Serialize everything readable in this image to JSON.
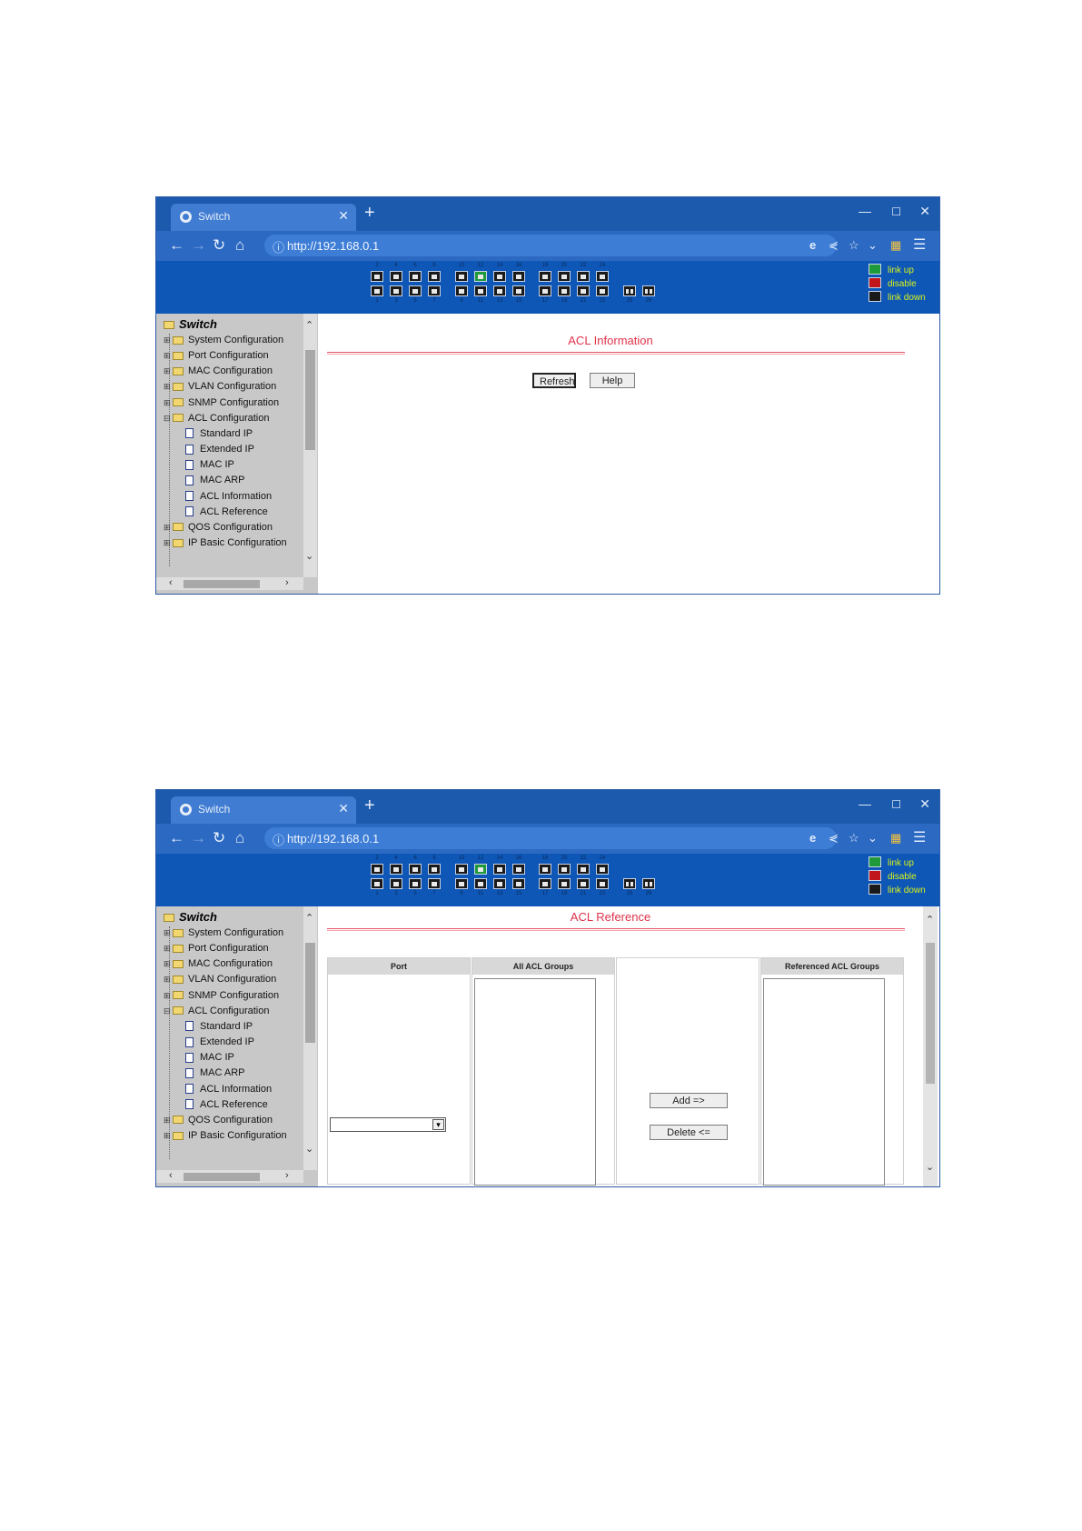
{
  "screenshots": [
    {
      "browser": {
        "tab_title": "Switch",
        "new_tab_symbol": "+",
        "url": "http://192.168.0.1"
      },
      "ports_top": [
        "2",
        "4",
        "6",
        "8",
        "10",
        "12",
        "14",
        "16",
        "18",
        "20",
        "22",
        "24"
      ],
      "ports_bottom": [
        "1",
        "3",
        "5",
        "7",
        "9",
        "11",
        "13",
        "15",
        "17",
        "19",
        "21",
        "23",
        "25",
        "26"
      ],
      "active_port": "12",
      "legend": [
        "link up",
        "disable",
        "link down"
      ],
      "tree": {
        "root": "Switch",
        "items": [
          "System Configuration",
          "Port Configuration",
          "MAC Configuration",
          "VLAN Configuration",
          "SNMP Configuration",
          "ACL Configuration",
          "QOS Configuration",
          "IP Basic Configuration"
        ],
        "acl_children": [
          "Standard IP",
          "Extended IP",
          "MAC IP",
          "MAC ARP",
          "ACL Information",
          "ACL Reference"
        ]
      },
      "page": {
        "title": "ACL Information",
        "refresh_label": "Refresh",
        "help_label": "Help"
      }
    },
    {
      "browser": {
        "tab_title": "Switch",
        "new_tab_symbol": "+",
        "url": "http://192.168.0.1"
      },
      "ports_top": [
        "2",
        "4",
        "6",
        "8",
        "10",
        "12",
        "14",
        "16",
        "18",
        "20",
        "22",
        "24"
      ],
      "ports_bottom": [
        "1",
        "3",
        "5",
        "7",
        "9",
        "11",
        "13",
        "15",
        "17",
        "19",
        "21",
        "23",
        "25",
        "26"
      ],
      "active_port": "12",
      "legend": [
        "link up",
        "disable",
        "link down"
      ],
      "tree": {
        "root": "Switch",
        "items": [
          "System Configuration",
          "Port Configuration",
          "MAC Configuration",
          "VLAN Configuration",
          "SNMP Configuration",
          "ACL Configuration",
          "QOS Configuration",
          "IP Basic Configuration"
        ],
        "acl_children": [
          "Standard IP",
          "Extended IP",
          "MAC IP",
          "MAC ARP",
          "ACL Information",
          "ACL Reference"
        ]
      },
      "page": {
        "title": "ACL Reference",
        "port_header": "Port",
        "all_groups_header": "All ACL Groups",
        "referenced_header": "Referenced ACL Groups",
        "add_label": "Add =>",
        "delete_label": "Delete <=",
        "port_selected": ""
      }
    }
  ],
  "colors": {
    "tab_bar": "#1c5aad",
    "address_bar": "#2c69c2",
    "device_header": "#0e57b6",
    "title_red": "#e0334a",
    "legend_text": "#d8f21a",
    "tree_bg": "#c8c8c8"
  }
}
